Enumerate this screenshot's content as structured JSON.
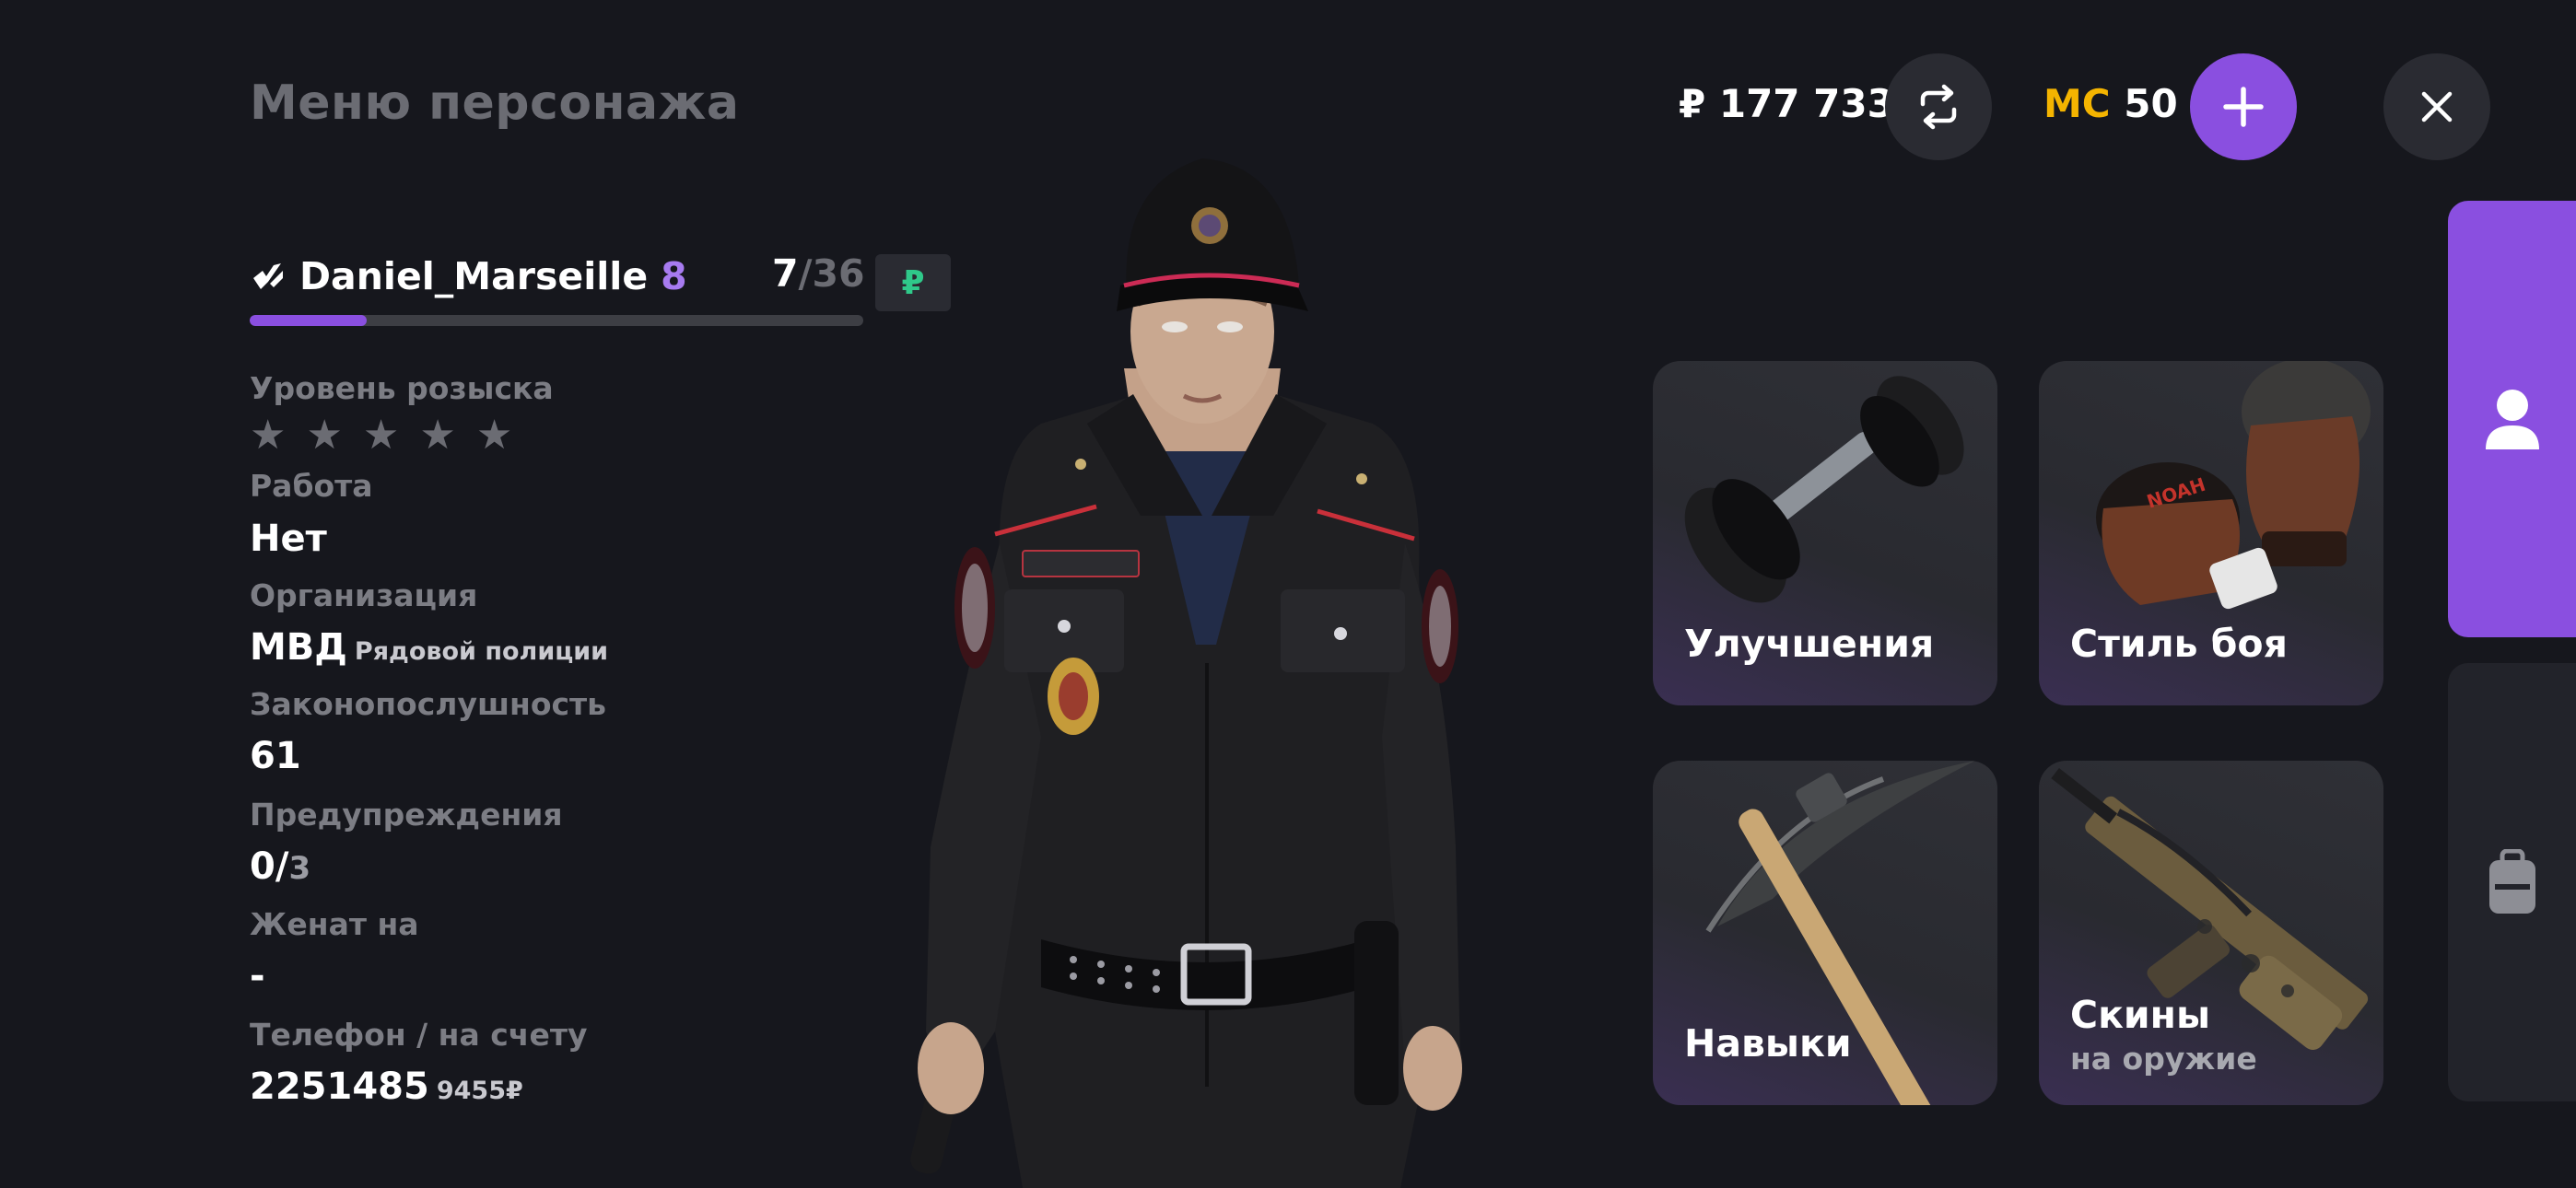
{
  "header": {
    "title": "Меню персонажа",
    "money": "₽ 177 733",
    "mc_currency": "MC",
    "mc_amount": "50"
  },
  "player": {
    "name": "Daniel_Marseille",
    "level": "8",
    "exp_current": "7",
    "exp_max": "/36",
    "ruble_badge": "₽",
    "xp_fraction": 0.19
  },
  "stats": {
    "wanted_label": "Уровень розыска",
    "wanted_stars_filled": 0,
    "wanted_stars_total": 5,
    "job_label": "Работа",
    "job_value": "Нет",
    "org_label": "Организация",
    "org_value": "МВД",
    "org_rank": "Рядовой полиции",
    "law_label": "Законопослушность",
    "law_value": "61",
    "warn_label": "Предупреждения",
    "warn_value": "0/",
    "warn_max": "3",
    "married_label": "Женат на",
    "married_value": "-",
    "phone_label": "Телефон / на счету",
    "phone_value": "2251485",
    "phone_balance": "9455₽"
  },
  "tiles": [
    {
      "label": "Улучшения",
      "sub": "",
      "icon": "dumbbell-icon"
    },
    {
      "label": "Стиль боя",
      "sub": "",
      "icon": "boxing-gloves-icon"
    },
    {
      "label": "Навыки",
      "sub": "",
      "icon": "pickaxe-icon"
    },
    {
      "label": "Скины",
      "sub": "на оружие",
      "icon": "rifle-icon"
    }
  ],
  "side_tabs": [
    {
      "icon": "user-icon",
      "active": true
    },
    {
      "icon": "backpack-icon",
      "active": false
    }
  ],
  "colors": {
    "background": "#16171d",
    "accent": "#8a4fe0",
    "mc": "#f4b400",
    "ruble_badge": "#2fc98a"
  }
}
